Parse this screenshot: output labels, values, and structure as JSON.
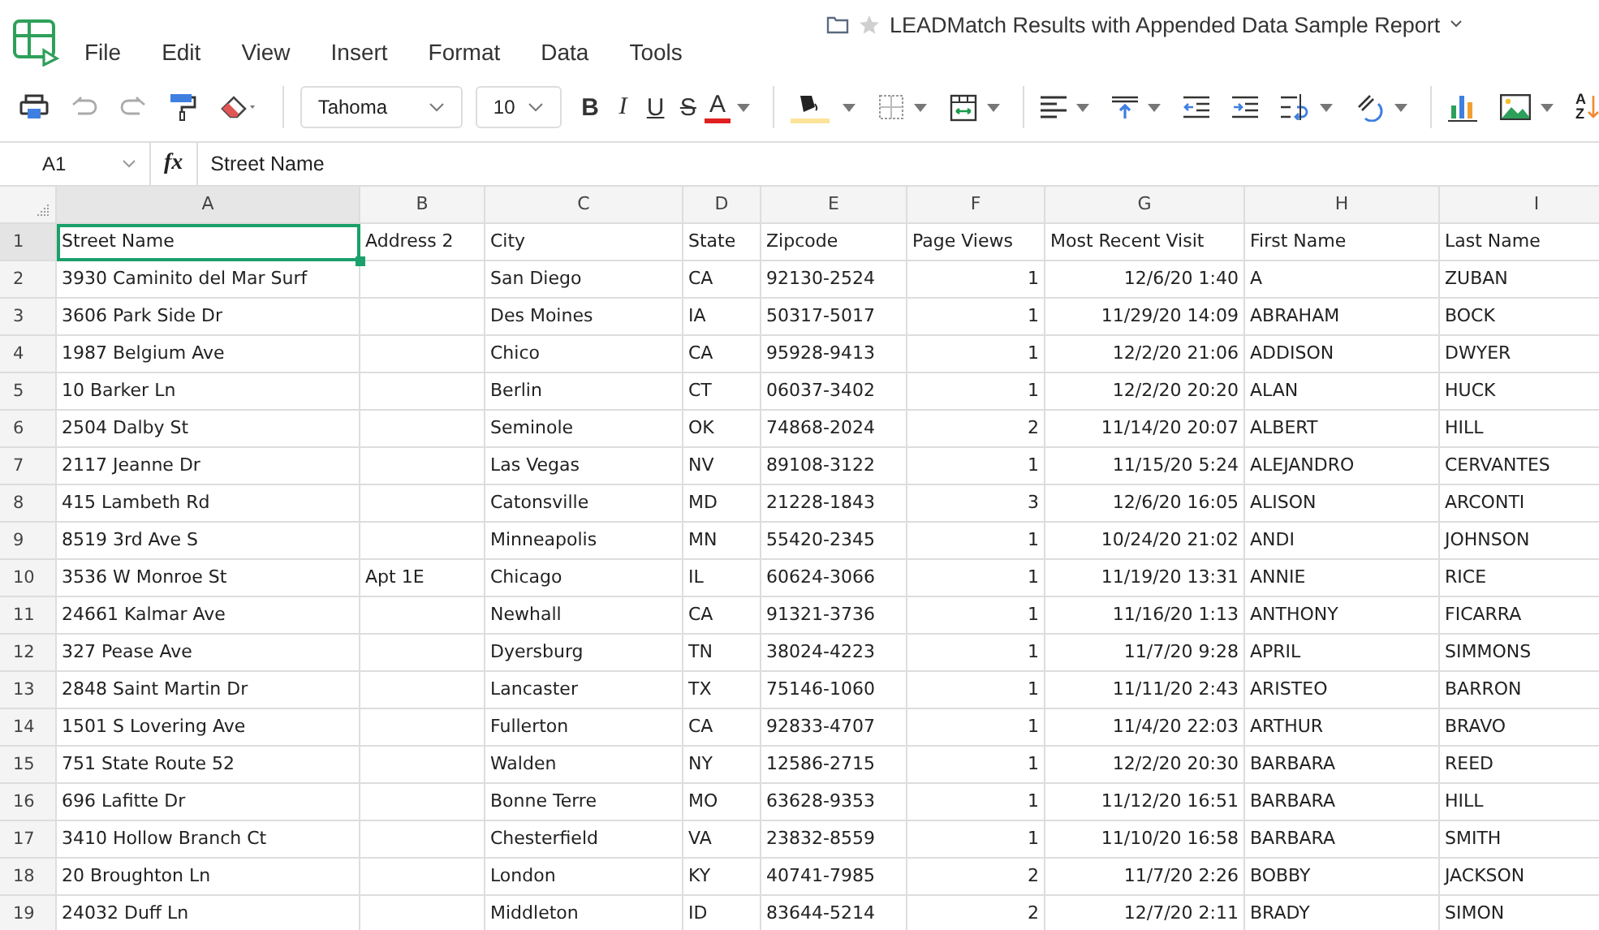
{
  "document": {
    "title": "LEADMatch Results with Appended Data Sample Report"
  },
  "menu": [
    "File",
    "Edit",
    "View",
    "Insert",
    "Format",
    "Data",
    "Tools"
  ],
  "toolbar": {
    "font": "Tahoma",
    "size": "10",
    "format_buttons": [
      {
        "label": "B",
        "kind": "bold"
      },
      {
        "label": "I",
        "kind": "italic"
      },
      {
        "label": "U",
        "kind": "underline"
      },
      {
        "label": "S",
        "kind": "strike"
      },
      {
        "label": "A",
        "kind": "color"
      }
    ],
    "sort_letters": [
      "A",
      "Z"
    ]
  },
  "formula_bar": {
    "cell": "A1",
    "fx": "fx",
    "value": "Street Name"
  },
  "grid": {
    "columns": [
      {
        "letter": "A",
        "kind": "text",
        "selected": true
      },
      {
        "letter": "B",
        "kind": "text",
        "selected": false
      },
      {
        "letter": "C",
        "kind": "text",
        "selected": false
      },
      {
        "letter": "D",
        "kind": "text",
        "selected": false
      },
      {
        "letter": "E",
        "kind": "text",
        "selected": false
      },
      {
        "letter": "F",
        "kind": "number",
        "selected": false
      },
      {
        "letter": "G",
        "kind": "number",
        "selected": false
      },
      {
        "letter": "H",
        "kind": "text",
        "selected": false
      },
      {
        "letter": "I",
        "kind": "text",
        "selected": false
      }
    ],
    "rows": [
      {
        "number": "1",
        "selected": true,
        "cells": [
          "Street Name",
          "Address 2",
          "City",
          "State",
          "Zipcode",
          "Page Views",
          "Most Recent Visit",
          "First Name",
          "Last Name"
        ]
      },
      {
        "number": "2",
        "selected": false,
        "cells": [
          "3930 Caminito del Mar Surf",
          "",
          "San Diego",
          "CA",
          "92130-2524",
          "1",
          "12/6/20 1:40",
          "A",
          "ZUBAN"
        ]
      },
      {
        "number": "3",
        "selected": false,
        "cells": [
          "3606 Park Side Dr",
          "",
          "Des Moines",
          "IA",
          "50317-5017",
          "1",
          "11/29/20 14:09",
          "ABRAHAM",
          "BOCK"
        ]
      },
      {
        "number": "4",
        "selected": false,
        "cells": [
          "1987 Belgium Ave",
          "",
          "Chico",
          "CA",
          "95928-9413",
          "1",
          "12/2/20 21:06",
          "ADDISON",
          "DWYER"
        ]
      },
      {
        "number": "5",
        "selected": false,
        "cells": [
          "10 Barker Ln",
          "",
          "Berlin",
          "CT",
          "06037-3402",
          "1",
          "12/2/20 20:20",
          "ALAN",
          "HUCK"
        ]
      },
      {
        "number": "6",
        "selected": false,
        "cells": [
          "2504 Dalby St",
          "",
          "Seminole",
          "OK",
          "74868-2024",
          "2",
          "11/14/20 20:07",
          "ALBERT",
          "HILL"
        ]
      },
      {
        "number": "7",
        "selected": false,
        "cells": [
          "2117 Jeanne Dr",
          "",
          "Las Vegas",
          "NV",
          "89108-3122",
          "1",
          "11/15/20 5:24",
          "ALEJANDRO",
          "CERVANTES"
        ]
      },
      {
        "number": "8",
        "selected": false,
        "cells": [
          "415 Lambeth Rd",
          "",
          "Catonsville",
          "MD",
          "21228-1843",
          "3",
          "12/6/20 16:05",
          "ALISON",
          "ARCONTI"
        ]
      },
      {
        "number": "9",
        "selected": false,
        "cells": [
          "8519 3rd Ave S",
          "",
          "Minneapolis",
          "MN",
          "55420-2345",
          "1",
          "10/24/20 21:02",
          "ANDI",
          "JOHNSON"
        ]
      },
      {
        "number": "10",
        "selected": false,
        "cells": [
          "3536 W Monroe St",
          "Apt 1E",
          "Chicago",
          "IL",
          "60624-3066",
          "1",
          "11/19/20 13:31",
          "ANNIE",
          "RICE"
        ]
      },
      {
        "number": "11",
        "selected": false,
        "cells": [
          "24661 Kalmar Ave",
          "",
          "Newhall",
          "CA",
          "91321-3736",
          "1",
          "11/16/20 1:13",
          "ANTHONY",
          "FICARRA"
        ]
      },
      {
        "number": "12",
        "selected": false,
        "cells": [
          "327 Pease Ave",
          "",
          "Dyersburg",
          "TN",
          "38024-4223",
          "1",
          "11/7/20 9:28",
          "APRIL",
          "SIMMONS"
        ]
      },
      {
        "number": "13",
        "selected": false,
        "cells": [
          "2848 Saint Martin Dr",
          "",
          "Lancaster",
          "TX",
          "75146-1060",
          "1",
          "11/11/20 2:43",
          "ARISTEO",
          "BARRON"
        ]
      },
      {
        "number": "14",
        "selected": false,
        "cells": [
          "1501 S Lovering Ave",
          "",
          "Fullerton",
          "CA",
          "92833-4707",
          "1",
          "11/4/20 22:03",
          "ARTHUR",
          "BRAVO"
        ]
      },
      {
        "number": "15",
        "selected": false,
        "cells": [
          "751 State Route 52",
          "",
          "Walden",
          "NY",
          "12586-2715",
          "1",
          "12/2/20 20:30",
          "BARBARA",
          "REED"
        ]
      },
      {
        "number": "16",
        "selected": false,
        "cells": [
          "696 Lafitte Dr",
          "",
          "Bonne Terre",
          "MO",
          "63628-9353",
          "1",
          "11/12/20 16:51",
          "BARBARA",
          "HILL"
        ]
      },
      {
        "number": "17",
        "selected": false,
        "cells": [
          "3410 Hollow Branch Ct",
          "",
          "Chesterfield",
          "VA",
          "23832-8559",
          "1",
          "11/10/20 16:58",
          "BARBARA",
          "SMITH"
        ]
      },
      {
        "number": "18",
        "selected": false,
        "cells": [
          "20 Broughton Ln",
          "",
          "London",
          "KY",
          "40741-7985",
          "2",
          "11/7/20 2:26",
          "BOBBY",
          "JACKSON"
        ]
      },
      {
        "number": "19",
        "selected": false,
        "cells": [
          "24032 Duff Ln",
          "",
          "Middleton",
          "ID",
          "83644-5214",
          "2",
          "12/7/20 2:11",
          "BRADY",
          "SIMON"
        ]
      }
    ]
  }
}
